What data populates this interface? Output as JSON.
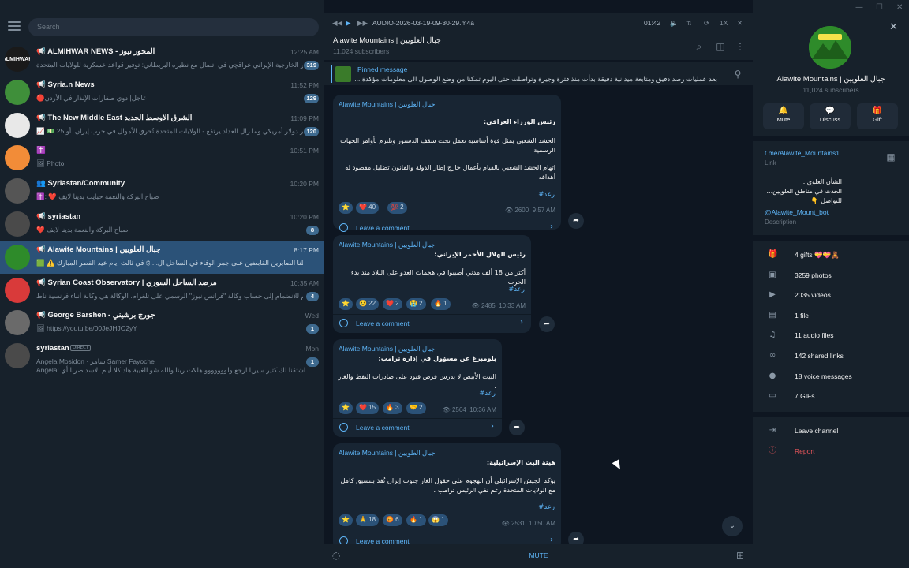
{
  "left": {
    "search_placeholder": "Search",
    "chats": [
      {
        "name": "📢 ALMIHWAR NEWS - المحور نيوز",
        "time": "12:25 AM",
        "preview": "وزير الخارجية الإيراني عراقچي في اتصال مع نظيره البريطاني: توفير قواعد عسكرية للولايات المتحدة...",
        "badge": "319",
        "avatar_text": "ALMIHWAR",
        "avatar_color": "#1a1a1a"
      },
      {
        "name": "📢 Syria.n News",
        "time": "11:52 PM",
        "preview": "🔴عاجل| دوي صفارات الإنذار في الأردن",
        "badge": "129",
        "avatar_text": "",
        "avatar_color": "#3f8f3a"
      },
      {
        "name": "📢 The New Middle East الشرق الأوسط الجديد",
        "time": "11:09 PM",
        "preview": "📈 💵 25 مليار دولار أمريكي وما زال العداد يرتفع - الولايات المتحدة تُحرق الأموال في حرب إيران. أو...",
        "badge": "120",
        "avatar_text": "",
        "avatar_color": "#e8e8e8"
      },
      {
        "name": "✝️",
        "time": "10:51 PM",
        "preview": "🖼 Photo",
        "badge": "",
        "avatar_text": "",
        "avatar_color": "#f28c38"
      },
      {
        "name": "👥 Syriastan/Community",
        "time": "10:20 PM",
        "preview": "✝️: ❤️ صباح البركة والنعمة حبايب بدينا لايف",
        "badge": "",
        "avatar_text": "",
        "avatar_color": "#555555"
      },
      {
        "name": "📢 syriastan",
        "time": "10:20 PM",
        "preview": "❤️ صباح البركة والنعمة بدينا لايف",
        "badge": "8",
        "avatar_text": "",
        "avatar_color": "#4a4a4a"
      },
      {
        "name": "📢 Alawite Mountains | جبال العلويين",
        "time": "8:17 PM",
        "preview": "🟩 ⚠️ إلى أهلنا الصابرين القابضين على جمر الوفاء في الساحل ال... 🕄 في ثالث ايام عيد الفطر المبارك 🕄",
        "badge": "",
        "avatar_text": "",
        "avatar_color": "#2e8b2a"
      },
      {
        "name": "📢 Syrian Coast Observatory | مرصد الساحل السوري",
        "time": "10:35 AM",
        "preview": "تدعوكم للانضمام إلى حساب وكالة \"فرانس نيوز\" الرسمي على تلغرام. الوكالة هي وكالة أنباء فرنسية ناط...",
        "badge": "4",
        "avatar_text": "",
        "avatar_color": "#d93a3a"
      },
      {
        "name": "📢 George Barshen - جورج برشيني",
        "time": "Wed",
        "preview": "🖼 https://youtu.be/00JeJHJO2yY",
        "badge": "1",
        "avatar_text": "",
        "avatar_color": "#6a6a6a"
      },
      {
        "name": "syriastan",
        "time": "Mon",
        "preview": "Angela  Mosidon  ·  سامر Samer  Fayoche",
        "badge": "1",
        "avatar_text": "",
        "avatar_color": "#4a4a4a"
      }
    ],
    "direct_label": "DIRECT",
    "last_line": "Angela: اشتقنا لك كتير سيريا ارجع ولووووووو هلكت ربنا والله شو الغيبة هاد كلا أيام الاسد صرنا أي..."
  },
  "player": {
    "track": "AUDIO-2026-03-19-09-30-29.m4a",
    "time": "01:42",
    "speed": "1X"
  },
  "header": {
    "title": "Alawite Mountains | جبال العلويين",
    "subscribers": "11,024 subscribers"
  },
  "pinned": {
    "label": "Pinned message",
    "text": "بعد عمليات رصد دقيق ومتابعة ميدانية دقيقة بدأت منذ فترة وجيزة وتواصلت حتى اليوم تمكنا من وضع الوصول الى معلومات مؤكدة ..."
  },
  "messages": [
    {
      "author": "Alawite Mountains | جبال العلويين",
      "heading": "رئيس الوزراء العراقي:",
      "p1": "الحشد الشعبي يمثل قوة أساسية تعمل تحت سقف الدستور وتلتزم بأوامر الجهات الرسمية",
      "p2": "اتهام الحشد الشعبي بالقيام بأعمال خارج إطار الدولة والقانون تضليل مقصود له أهدافه",
      "tag": "#رعد",
      "reactions": [
        "⭐",
        "❤️ 40",
        "💯 2"
      ],
      "views": "2600",
      "time": "9:57 AM",
      "comment": "Leave a comment"
    },
    {
      "author": "Alawite Mountains | جبال العلويين",
      "heading": "رئيس الهلال الأحمر الإيراني:",
      "p1": "أكثر من 18 ألف مدني أصيبوا في هجمات العدو على البلاد منذ بدء الحرب",
      "p2": "",
      "tag": "#رعد",
      "reactions": [
        "⭐",
        "😢 22",
        "❤️ 2",
        "😭 2",
        "🔥 1"
      ],
      "views": "2485",
      "time": "10:33 AM",
      "comment": "Leave a comment"
    },
    {
      "author": "Alawite Mountains | جبال العلويين",
      "heading": "بلومبرغ عن مسؤول في إدارة ترامب:",
      "p1": "البيت الأبيض لا يدرس فرض قيود على صادرات النفط والغاز .",
      "p2": "",
      "tag": "#رعد",
      "reactions": [
        "⭐",
        "❤️ 15",
        "🔥 3",
        "🤝 2"
      ],
      "views": "2564",
      "time": "10:36 AM",
      "comment": "Leave a comment"
    },
    {
      "author": "Alawite Mountains | جبال العلويين",
      "heading": "هيئة البث الإسرائيلية:",
      "p1": "يؤكد الجيش الإسرائيلي أن الهجوم على حقول الغاز جنوب إيران نُفذ بتنسيق كامل مع الولايات المتحدة رغم نفي الرئيس ترامب .",
      "p2": "",
      "tag": "#رعد",
      "reactions": [
        "⭐",
        "🙏 18",
        "😡 6",
        "🔥 1",
        "😱 1"
      ],
      "views": "2531",
      "time": "10:50 AM",
      "comment": "Leave a comment"
    }
  ],
  "bottom": {
    "mute": "MUTE"
  },
  "right": {
    "title": "Alawite Mountains | جبال العلويين",
    "subscribers": "11,024 subscribers",
    "actions": [
      "Mute",
      "Discuss",
      "Gift"
    ],
    "link": "t.me/Alawite_Mountains1",
    "link_label": "Link",
    "desc_lines": [
      "الشأن العلوي...",
      "الحدث في مناطق العلويين...",
      "للتواصل 👇"
    ],
    "bot": "@Alawite_Mount_bot",
    "desc_label": "Description",
    "stats": [
      {
        "icon": "gift-icon",
        "glyph": "🎁",
        "text": "4 gifts 💝💝🧸"
      },
      {
        "icon": "photo-icon",
        "glyph": "▣",
        "text": "3259 photos"
      },
      {
        "icon": "video-icon",
        "glyph": "▶",
        "text": "2035 videos"
      },
      {
        "icon": "file-icon",
        "glyph": "▤",
        "text": "1 file"
      },
      {
        "icon": "headphones-icon",
        "glyph": "♫",
        "text": "11 audio files"
      },
      {
        "icon": "link-icon",
        "glyph": "∞",
        "text": "142 shared links"
      },
      {
        "icon": "mic-icon",
        "glyph": "●",
        "text": "18 voice messages"
      },
      {
        "icon": "gif-icon",
        "glyph": "▭",
        "text": "7 GIFs"
      }
    ],
    "leave": "Leave channel",
    "report": "Report"
  }
}
